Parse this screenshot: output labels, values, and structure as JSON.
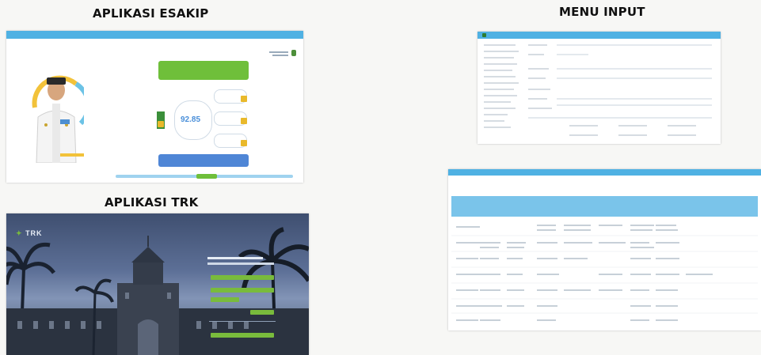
{
  "headings": {
    "esakip": "APLIKASI ESAKIP",
    "menu_input": "MENU INPUT",
    "trk": "APLIKASI TRK"
  },
  "esakip": {
    "score": "92.85",
    "colors": {
      "topbar": "#4fb1e3",
      "green": "#6fbf3a",
      "blue": "#4f86d6",
      "yellow": "#e9b92b"
    }
  },
  "trk": {
    "logo": "TRK",
    "colors": {
      "button": "#79bb3c"
    }
  }
}
